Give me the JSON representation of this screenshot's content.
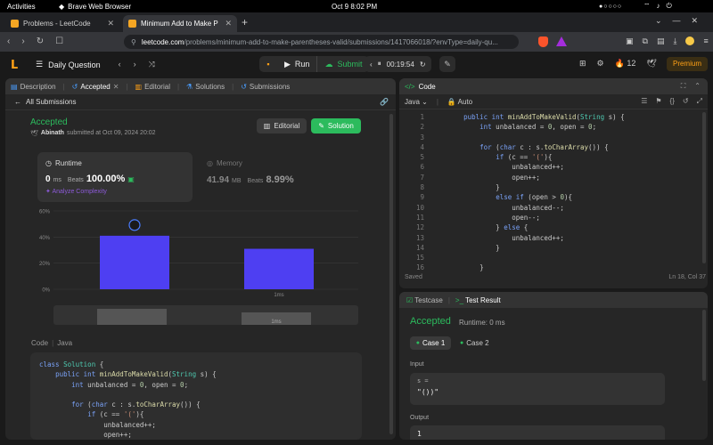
{
  "os": {
    "activities": "Activities",
    "app_name": "Brave Web Browser",
    "clock": "Oct 9  8:02 PM"
  },
  "browser": {
    "tabs": [
      {
        "title": "Problems - LeetCode"
      },
      {
        "title": "Minimum Add to Make P"
      }
    ],
    "url_host": "leetcode.com",
    "url_path": "/problems/minimum-add-to-make-parentheses-valid/submissions/1417066018/?envType=daily-qu..."
  },
  "lc_nav": {
    "daily_question": "Daily Question",
    "run": "Run",
    "submit": "Submit",
    "timer": "00:19:54",
    "streak": "12",
    "premium": "Premium"
  },
  "left_tabs": [
    {
      "label": "Description"
    },
    {
      "label": "Accepted"
    },
    {
      "label": "Editorial"
    },
    {
      "label": "Solutions"
    },
    {
      "label": "Submissions"
    }
  ],
  "submission": {
    "back_label": "All Submissions",
    "status": "Accepted",
    "author": "Abinath",
    "submitted_text": "submitted at Oct 09, 2024 20:02",
    "editorial_btn": "Editorial",
    "solution_btn": "Solution"
  },
  "runtime": {
    "label": "Runtime",
    "value": "0",
    "unit": "ms",
    "beats_label": "Beats",
    "beats": "100.00%",
    "complexity": "Analyze Complexity"
  },
  "memory": {
    "label": "Memory",
    "value": "41.94",
    "unit": "MB",
    "beats_label": "Beats",
    "beats": "8.99%"
  },
  "chart_data": {
    "type": "bar",
    "y_ticks": [
      "60%",
      "40%",
      "20%",
      "0%"
    ],
    "ylim": [
      0,
      60
    ],
    "x_label": "1ms",
    "bars": [
      {
        "value": 41,
        "color": "#4e3ff2"
      },
      {
        "value": 31,
        "color": "#4e3ff2"
      }
    ],
    "mini_label": "1ms"
  },
  "code_section": {
    "label": "Code",
    "lang": "Java"
  },
  "editor": {
    "title": "Code",
    "lang": "Java",
    "mode": "Auto",
    "status": "Saved",
    "cursor": "Ln 18, Col 37",
    "line_numbers": [
      "1",
      "2",
      "3",
      "4",
      "5",
      "6",
      "7",
      "8",
      "9",
      "10",
      "11",
      "12",
      "13",
      "14",
      "15",
      "16"
    ]
  },
  "testcase": {
    "tab1": "Testcase",
    "tab2": "Test Result",
    "status": "Accepted",
    "runtime": "Runtime: 0 ms",
    "case1": "Case 1",
    "case2": "Case 2",
    "input_label": "Input",
    "input_key": "s =",
    "input_value": "\"())\"",
    "output_label": "Output",
    "output_value": "1"
  }
}
